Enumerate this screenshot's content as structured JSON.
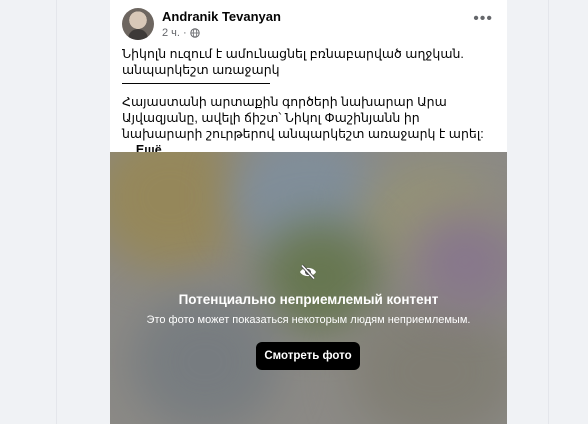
{
  "post": {
    "author": "Andranik Tevanyan",
    "time": "2 ч.",
    "more_icon": "more-horizontal-icon",
    "text_line1": "Նիկոլն ուզում է ամունացնել բռնաբարված աղջկան. անպարկեշտ առաջարկ",
    "text_line2": "Հայաստանի արտաքին գործերի նախարար Արա Այվազյանը, ավելի ճիշտ՝ Նիկոլ Փաշինյանն իր նախարարի շուրթերով անպարկեշտ առաջարկ է արել:",
    "ellipsis": "...",
    "more_label": "Ещё"
  },
  "media": {
    "warning_icon": "eye-off-icon",
    "warning_title": "Потенциально неприемлемый контент",
    "warning_subtitle": "Это фото может показаться некоторым людям неприемлемым.",
    "view_button": "Смотреть фото"
  },
  "colors": {
    "card": "#ffffff",
    "background": "#f0f2f5",
    "secondary_text": "#65676b",
    "button": "#000000"
  }
}
